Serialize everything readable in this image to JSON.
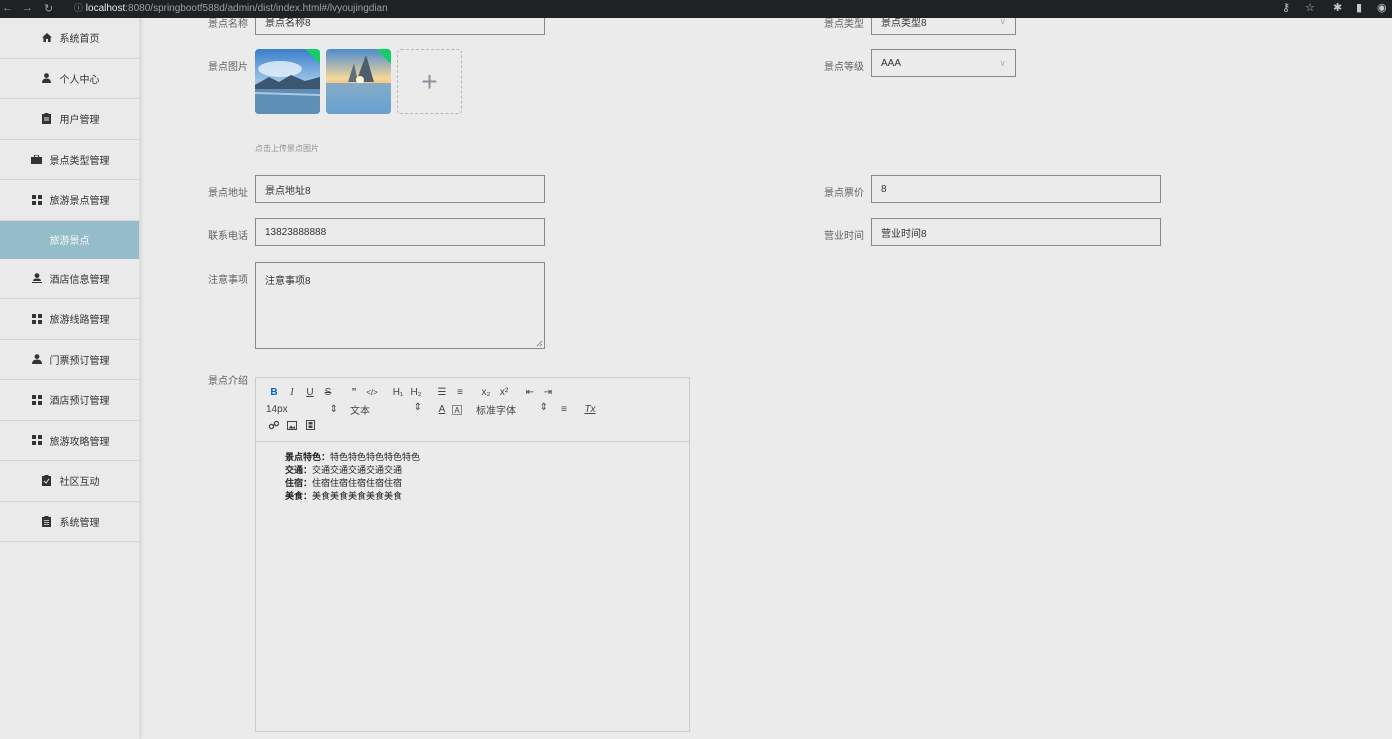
{
  "browser": {
    "url_host": "localhost",
    "url_rest": ":8080/springbootf588d/admin/dist/index.html#/lvyoujingdian"
  },
  "sidebar": {
    "items": [
      {
        "label": "系统首页",
        "icon": "home-icon"
      },
      {
        "label": "个人中心",
        "icon": "user-icon"
      },
      {
        "label": "用户管理",
        "icon": "clipboard-icon"
      },
      {
        "label": "景点类型管理",
        "icon": "briefcase-icon"
      },
      {
        "label": "旅游景点管理",
        "icon": "grid-icon"
      },
      {
        "label": "旅游景点",
        "icon": "",
        "sub": true
      },
      {
        "label": "酒店信息管理",
        "icon": "person-icon"
      },
      {
        "label": "旅游线路管理",
        "icon": "grid-icon"
      },
      {
        "label": "门票预订管理",
        "icon": "user-icon"
      },
      {
        "label": "酒店预订管理",
        "icon": "grid-icon"
      },
      {
        "label": "旅游攻略管理",
        "icon": "grid-icon"
      },
      {
        "label": "社区互动",
        "icon": "clipboard-icon"
      },
      {
        "label": "系统管理",
        "icon": "clipboard-icon"
      }
    ]
  },
  "form": {
    "name_label": "景点名称",
    "name_value": "景点名称8",
    "type_label": "景点类型",
    "type_value": "景点类型8",
    "images_label": "景点图片",
    "upload_tip": "点击上传景点图片",
    "level_label": "景点等级",
    "level_value": "AAA",
    "address_label": "景点地址",
    "address_value": "景点地址8",
    "price_label": "景点票价",
    "price_value": "8",
    "phone_label": "联系电话",
    "phone_value": "13823888888",
    "hours_label": "营业时间",
    "hours_value": "营业时间8",
    "notes_label": "注意事项",
    "notes_value": "注意事项8",
    "intro_label": "景点介绍"
  },
  "editor": {
    "toolbar": {
      "bold": "B",
      "italic": "I",
      "underline": "U",
      "strike": "S",
      "quote": "”",
      "code": "</>",
      "h1": "H₁",
      "h2": "H₂",
      "ol": "☰",
      "ul": "≡",
      "sub": "x₂",
      "sup": "x²",
      "outdent": "⇤",
      "indent": "⇥",
      "size": "14px",
      "header": "文本",
      "font": "标准字体",
      "align": "≡",
      "clean": "Tx"
    },
    "content": [
      {
        "label": "景点特色：",
        "text": "特色特色特色特色特色"
      },
      {
        "label": "交通：",
        "text": "交通交通交通交通交通"
      },
      {
        "label": "住宿：",
        "text": "住宿住宿住宿住宿住宿"
      },
      {
        "label": "美食：",
        "text": "美食美食美食美食美食"
      }
    ]
  }
}
